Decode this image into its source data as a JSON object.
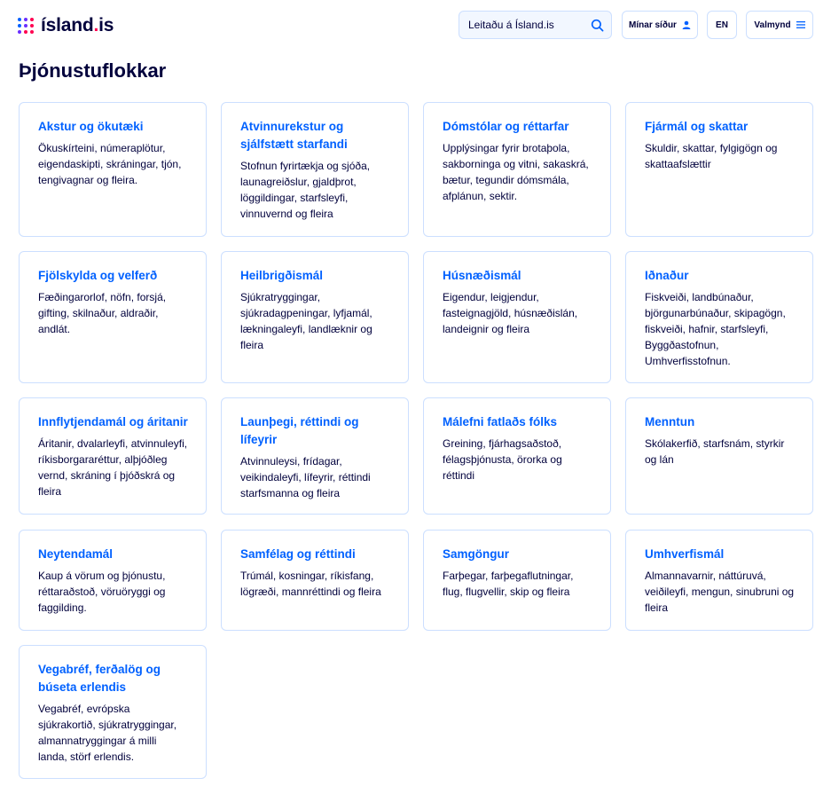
{
  "header": {
    "logo_text": "ísland",
    "logo_dot": ".",
    "logo_suffix": "is",
    "logo_dot_colors": [
      "#0061ff",
      "#6a2eff",
      "#ff0050",
      "#0061ff",
      "#6a2eff",
      "#ff0050",
      "#6a2eff",
      "#ff0050",
      "#ff0050"
    ],
    "search_placeholder": "Leitaðu á Ísland.is",
    "my_pages_label": "Mínar síður",
    "lang_label": "EN",
    "menu_label": "Valmynd"
  },
  "page_title": "Þjónustuflokkar",
  "categories": [
    {
      "title": "Akstur og ökutæki",
      "description": "Ökuskírteini, númeraplötur, eigendaskipti, skráningar, tjón, tengivagnar og fleira."
    },
    {
      "title": "Atvinnurekstur og sjálfstætt starfandi",
      "description": "Stofnun fyrirtækja og sjóða, launagreiðslur, gjaldþrot, löggildingar, starfsleyfi, vinnuvernd og fleira"
    },
    {
      "title": "Dómstólar og réttarfar",
      "description": "Upplýsingar fyrir brotaþola, sakborninga og vitni, sakaskrá, bætur, tegundir dómsmála, afplánun, sektir."
    },
    {
      "title": "Fjármál og skattar",
      "description": "Skuldir, skattar, fylgigögn og skattaafslættir"
    },
    {
      "title": "Fjölskylda og velferð",
      "description": "Fæðingarorlof, nöfn, forsjá, gifting, skilnaður, aldraðir, andlát."
    },
    {
      "title": "Heilbrigðismál",
      "description": "Sjúkratryggingar, sjúkradagpeningar, lyfjamál, lækningaleyfi, landlæknir og fleira"
    },
    {
      "title": "Húsnæðismál",
      "description": "Eigendur, leigjendur, fasteignagjöld, húsnæðislán, landeignir og fleira"
    },
    {
      "title": "Iðnaður",
      "description": "Fiskveiði, landbúnaður, björgunarbúnaður, skipagögn, fiskveiði, hafnir, starfsleyfi, Byggðastofnun, Umhverfisstofnun."
    },
    {
      "title": "Innflytjendamál og áritanir",
      "description": "Áritanir, dvalarleyfi, atvinnuleyfi, ríkisborgararéttur, alþjóðleg vernd, skráning í þjóðskrá og fleira"
    },
    {
      "title": "Launþegi, réttindi og lífeyrir",
      "description": "Atvinnuleysi, frídagar, veikindaleyfi, lífeyrir, réttindi starfsmanna og fleira"
    },
    {
      "title": "Málefni fatlaðs fólks",
      "description": "Greining, fjárhagsaðstoð, félagsþjónusta, örorka og réttindi"
    },
    {
      "title": "Menntun",
      "description": "Skólakerfið, starfsnám, styrkir og lán"
    },
    {
      "title": "Neytendamál",
      "description": "Kaup á vörum og þjónustu, réttaraðstoð, vöruöryggi og faggilding."
    },
    {
      "title": "Samfélag og réttindi",
      "description": "Trúmál, kosningar, ríkisfang, lögræði, mannréttindi og fleira"
    },
    {
      "title": "Samgöngur",
      "description": "Farþegar, farþegaflutningar, flug, flugvellir, skip og fleira"
    },
    {
      "title": "Umhverfismál",
      "description": "Almannavarnir, náttúruvá, veiðileyfi, mengun, sinubruni og fleira"
    },
    {
      "title": "Vegabréf, ferðalög og búseta erlendis",
      "description": "Vegabréf, evrópska sjúkrakortið, sjúkratryggingar, almannatryggingar á milli landa, störf erlendis."
    }
  ]
}
